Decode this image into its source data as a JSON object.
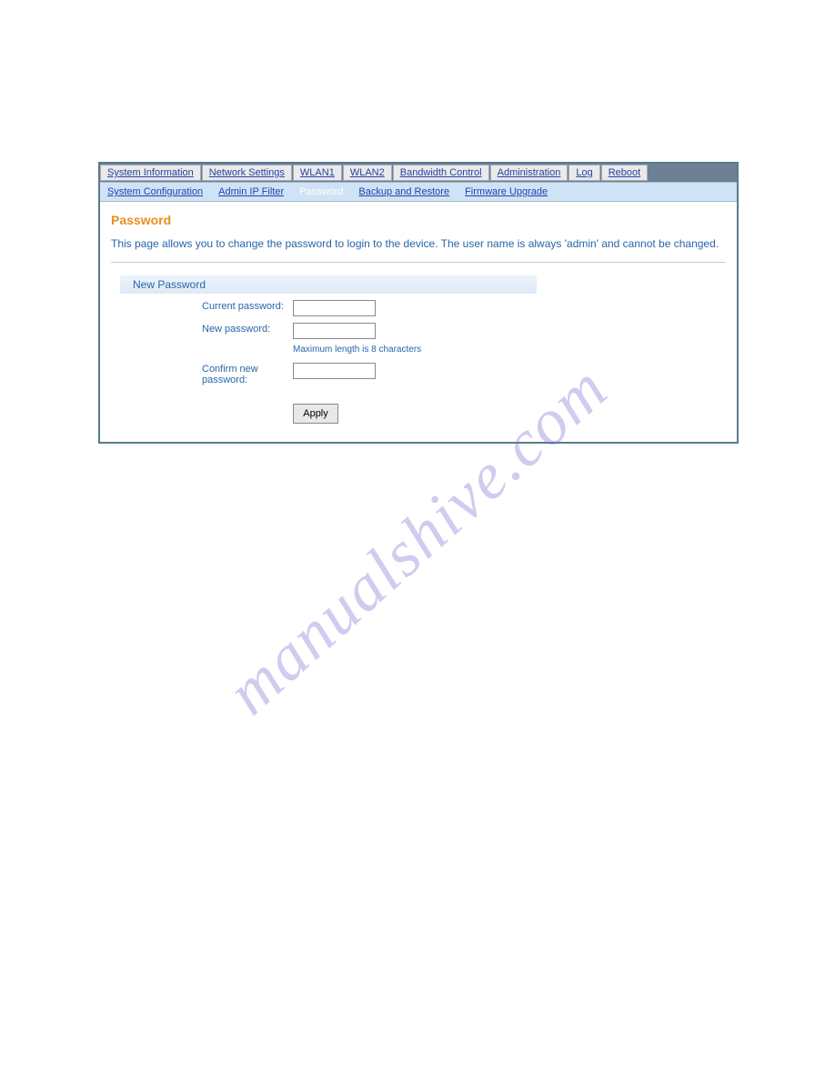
{
  "primary_tabs": {
    "system_information": "System Information",
    "network_settings": "Network Settings",
    "wlan1": "WLAN1",
    "wlan2": "WLAN2",
    "bandwidth_control": "Bandwidth Control",
    "administration": "Administration",
    "log": "Log",
    "reboot": "Reboot"
  },
  "secondary_tabs": {
    "system_configuration": "System Configuration",
    "admin_ip_filter": "Admin IP Filter",
    "password": "Password",
    "backup_restore": "Backup and Restore",
    "firmware_upgrade": "Firmware Upgrade"
  },
  "page": {
    "title": "Password",
    "description": "This page allows you to change the password to login to the device. The user name is always 'admin' and cannot be changed.",
    "section_header": "New Password",
    "labels": {
      "current_password": "Current password:",
      "new_password": "New password:",
      "confirm_password": "Confirm new password:"
    },
    "hint": "Maximum length is 8 characters",
    "apply_button": "Apply"
  },
  "watermark": "manualshive.com"
}
